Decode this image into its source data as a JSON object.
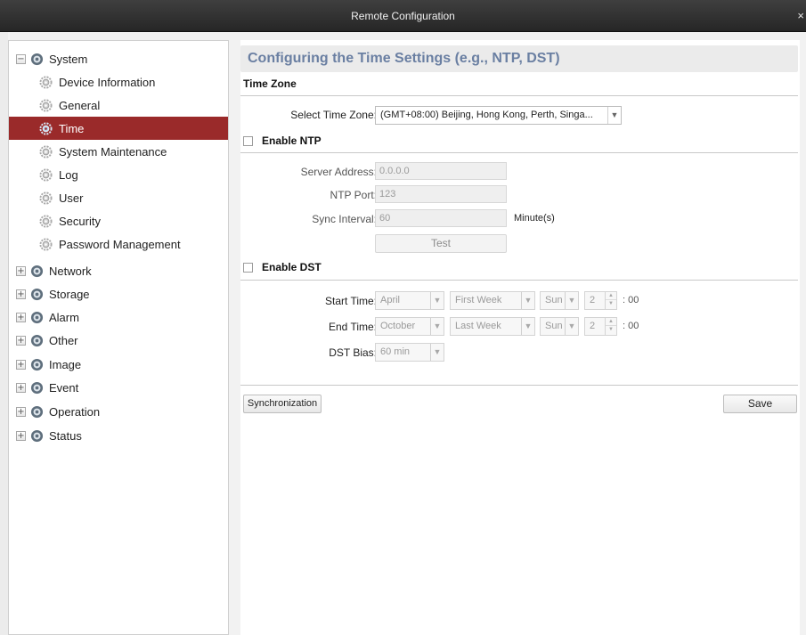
{
  "window": {
    "title": "Remote Configuration",
    "close_glyph": "×"
  },
  "sidebar": {
    "system": {
      "label": "System",
      "expander": "−"
    },
    "system_children": [
      {
        "label": "Device Information",
        "icon": "gear-icon"
      },
      {
        "label": "General",
        "icon": "gear-icon"
      },
      {
        "label": "Time",
        "icon": "gear-icon",
        "selected": true
      },
      {
        "label": "System Maintenance",
        "icon": "gear-icon"
      },
      {
        "label": "Log",
        "icon": "gear-icon"
      },
      {
        "label": "User",
        "icon": "gear-icon"
      },
      {
        "label": "Security",
        "icon": "gear-icon"
      },
      {
        "label": "Password Management",
        "icon": "gear-icon"
      }
    ],
    "categories": [
      {
        "label": "Network",
        "expander": "+"
      },
      {
        "label": "Storage",
        "expander": "+"
      },
      {
        "label": "Alarm",
        "expander": "+"
      },
      {
        "label": "Other",
        "expander": "+"
      },
      {
        "label": "Image",
        "expander": "+"
      },
      {
        "label": "Event",
        "expander": "+"
      },
      {
        "label": "Operation",
        "expander": "+"
      },
      {
        "label": "Status",
        "expander": "+"
      }
    ]
  },
  "main": {
    "title": "Configuring the Time Settings (e.g., NTP, DST)",
    "time_zone": {
      "heading": "Time Zone",
      "select_label": "Select Time Zone:",
      "select_value": "(GMT+08:00) Beijing, Hong Kong, Perth, Singa..."
    },
    "ntp": {
      "enable_label": "Enable NTP",
      "enabled": false,
      "server_label": "Server Address:",
      "server_value": "0.0.0.0",
      "port_label": "NTP Port:",
      "port_value": "123",
      "interval_label": "Sync Interval:",
      "interval_value": "60",
      "interval_unit": "Minute(s)",
      "test_button": "Test"
    },
    "dst": {
      "enable_label": "Enable DST",
      "enabled": false,
      "start_label": "Start Time:",
      "start_month": "April",
      "start_week": "First Week",
      "start_day": "Sun",
      "start_hour": "2",
      "start_minutes": ": 00",
      "end_label": "End Time:",
      "end_month": "October",
      "end_week": "Last Week",
      "end_day": "Sun",
      "end_hour": "2",
      "end_minutes": ": 00",
      "bias_label": "DST Bias:",
      "bias_value": "60 min"
    },
    "sync_button": "Synchronization",
    "save_button": "Save"
  },
  "colors": {
    "selected_row": "#9a2a2a",
    "title_text": "#6a7fa2",
    "titlebar": "#2e2e2e"
  }
}
